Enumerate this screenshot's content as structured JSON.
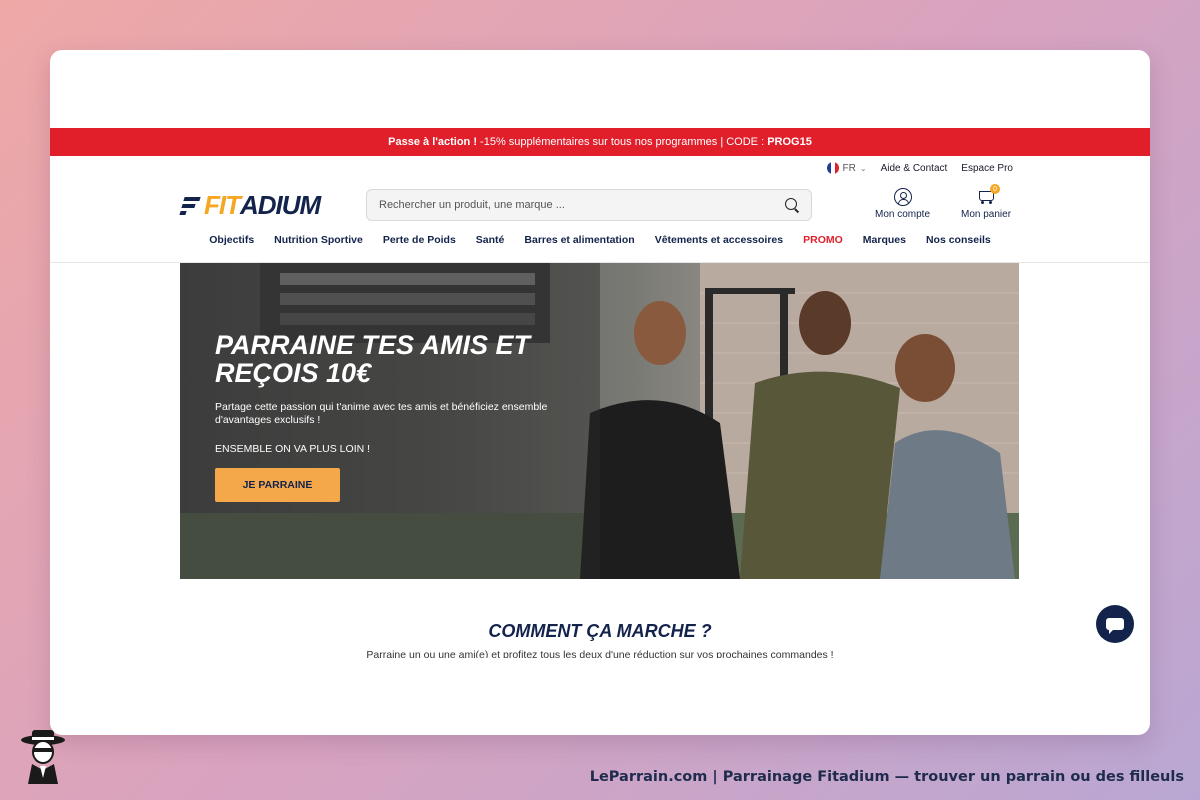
{
  "promo_bar": {
    "lead": "Passe à l'action !",
    "text": " -15% supplémentaires sur tous nos programmes | CODE : ",
    "code": "PROG15"
  },
  "topbar": {
    "language": "FR",
    "help": "Aide & Contact",
    "pro": "Espace Pro"
  },
  "header": {
    "logo_fit": "FIT",
    "logo_adium": "ADIUM",
    "search_placeholder": "Rechercher un produit, une marque ...",
    "account_label": "Mon compte",
    "cart_label": "Mon panier",
    "cart_count": "0"
  },
  "nav": {
    "items": [
      "Objectifs",
      "Nutrition Sportive",
      "Perte de Poids",
      "Santé",
      "Barres et alimentation",
      "Vêtements et accessoires",
      "PROMO",
      "Marques",
      "Nos conseils"
    ]
  },
  "hero": {
    "title_line1": "PARRAINE TES AMIS ET",
    "title_line2": "REÇOIS 10€",
    "subtitle": "Partage cette passion qui t'anime avec tes amis et bénéficiez ensemble d'avantages exclusifs !",
    "subtitle2": "ENSEMBLE ON VA PLUS LOIN !",
    "button": "JE PARRAINE"
  },
  "how": {
    "title": "COMMENT ÇA MARCHE ?",
    "subtitle": "Parraine un ou une ami(e) et profitez tous les deux d'une réduction sur vos prochaines commandes !"
  },
  "footer": {
    "caption": "LeParrain.com | Parrainage Fitadium — trouver un parrain ou des filleuls"
  },
  "colors": {
    "brand_navy": "#13234b",
    "brand_orange": "#f5a623",
    "promo_red": "#e01f2b",
    "button_orange": "#f5a84a"
  }
}
